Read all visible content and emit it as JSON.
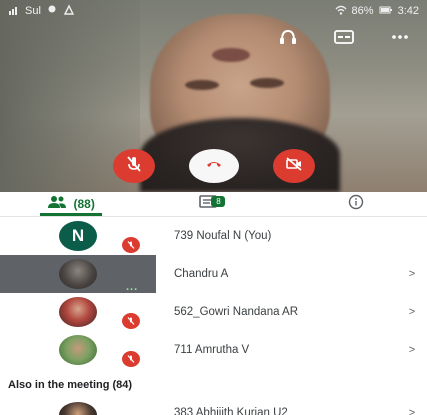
{
  "status_bar": {
    "carrier": "Sul",
    "battery_text": "86%",
    "time": "3:42"
  },
  "video_tools": {
    "captions_label": "CC",
    "more_label": "..."
  },
  "tabs": {
    "people_count": "(88)",
    "chat_badge": "8"
  },
  "participants": [
    {
      "avatar_letter": "N",
      "name": "739 Noufal N (You)",
      "chevron": "",
      "muted": true
    },
    {
      "avatar_letter": "",
      "name": "Chandru A",
      "chevron": ">",
      "muted": false,
      "speaking": "..."
    },
    {
      "avatar_letter": "",
      "name": "562_Gowri Nandana AR",
      "chevron": ">",
      "muted": true
    },
    {
      "avatar_letter": "",
      "name": "711 Amrutha V",
      "chevron": ">",
      "muted": true
    }
  ],
  "also_in_meeting": {
    "title": "Also in the meeting (84)",
    "first_row_name": "383 Abhijith Kurian U2",
    "first_row_chevron": ">"
  },
  "colors": {
    "accent_green": "#137333",
    "control_red": "#dc3b30",
    "avatar_teal": "#0b5d4a"
  }
}
